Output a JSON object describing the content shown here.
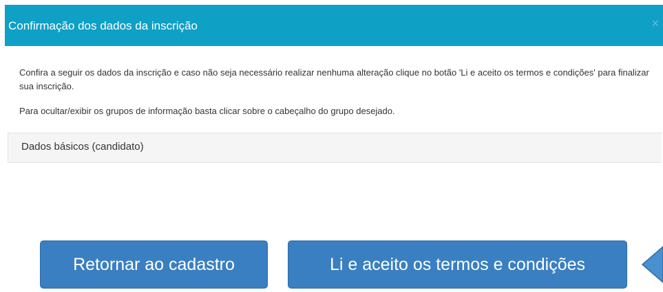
{
  "modal": {
    "title": "Confirmação dos dados da inscrição",
    "close_label": "×",
    "paragraph_1": "Confira a seguir os dados da inscrição e caso não seja necessário realizar nenhuma alteração clique no botão 'Li e aceito os termos e condições' para finalizar sua inscrição.",
    "paragraph_2": "Para ocultar/exibir os grupos de informação basta clicar sobre o cabeçalho do grupo desejado.",
    "groups": [
      {
        "label": "Dados básicos (candidato)"
      }
    ]
  },
  "actions": {
    "back_label": "Retornar ao cadastro",
    "accept_label": "Li e aceito os termos e condições"
  },
  "colors": {
    "header": "#0fa0c6",
    "button": "#3a7fc1",
    "pointer": "#4a8fd0"
  },
  "icons": {
    "close": "close-icon",
    "pointer": "arrow-pointer-icon"
  }
}
